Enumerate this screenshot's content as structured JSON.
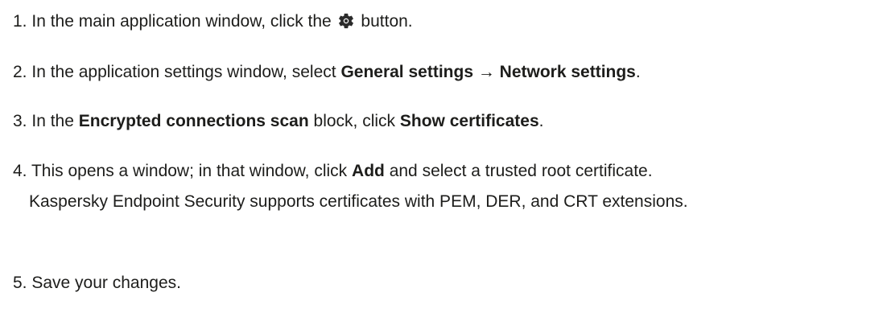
{
  "steps": [
    {
      "number": "1.",
      "text_before": "In the main application window, click the",
      "icon": "gear-icon",
      "text_after": "button."
    },
    {
      "number": "2.",
      "text_before": "In the application settings window, select",
      "bold": "General settings → Network settings",
      "text_after": "."
    },
    {
      "number": "3.",
      "text_before": "In the",
      "bold1": "Encrypted connections scan",
      "text_mid": "block, click",
      "bold2": "Show certificates",
      "text_after": "."
    },
    {
      "number": "4.",
      "text_before": "This opens a window; in that window, click",
      "bold": "Add",
      "text_after": "and select a trusted root certificate.",
      "note": "Kaspersky Endpoint Security supports certificates with PEM, DER, and CRT extensions."
    },
    {
      "number": "5.",
      "text": "Save your changes."
    }
  ]
}
